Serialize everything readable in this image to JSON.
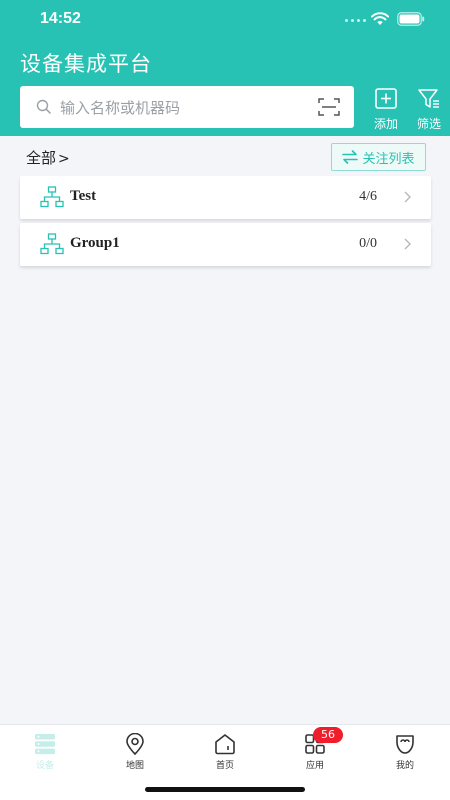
{
  "status_bar": {
    "time": "14:52"
  },
  "header": {
    "title": "设备集成平台",
    "search_placeholder": "输入名称或机器码",
    "add_label": "添加",
    "filter_label": "筛选",
    "bg_color": "#27c2b3"
  },
  "breadcrumb": {
    "label": "全部",
    "chevron": ">"
  },
  "follow_button": {
    "label": "关注列表"
  },
  "groups": [
    {
      "name": "Test",
      "count": "4/6"
    },
    {
      "name": "Group1",
      "count": "0/0"
    }
  ],
  "tabbar": {
    "items": [
      {
        "label": "设备",
        "icon": "devices-icon",
        "active": true
      },
      {
        "label": "地图",
        "icon": "map-pin-icon"
      },
      {
        "label": "首页",
        "icon": "home-icon"
      },
      {
        "label": "应用",
        "icon": "apps-icon",
        "badge": "56"
      },
      {
        "label": "我的",
        "icon": "profile-icon"
      }
    ],
    "badge_color": "#f01e2c"
  }
}
